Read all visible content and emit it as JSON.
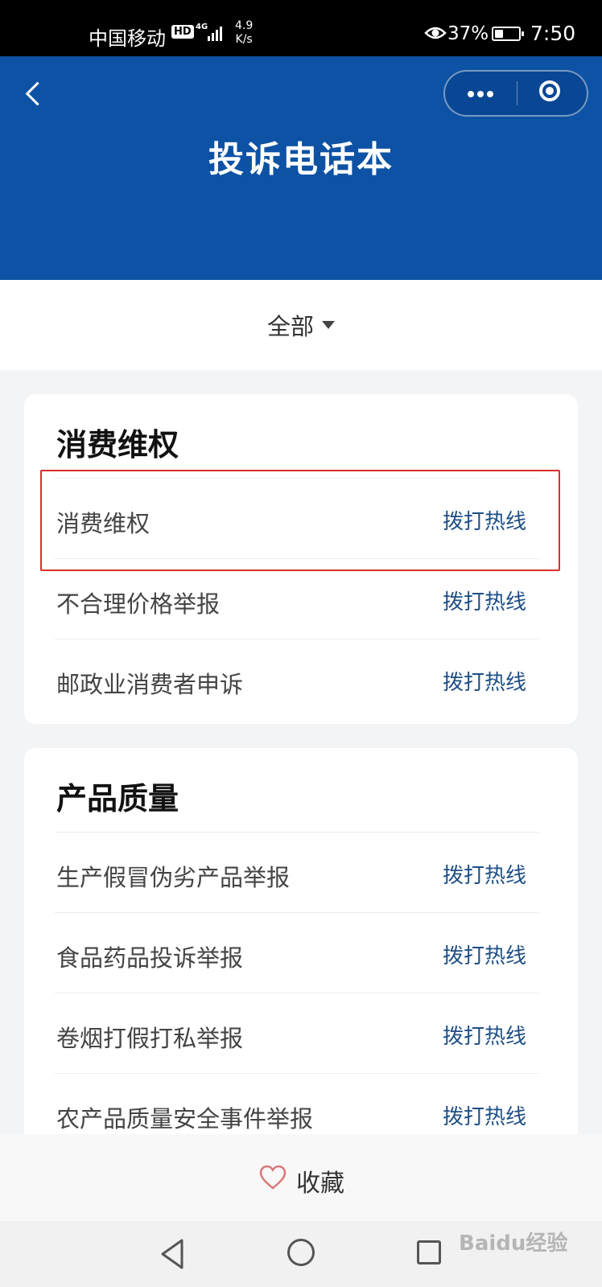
{
  "status_bar": {
    "carrier": "中国移动",
    "hd": "HD",
    "network": "4G",
    "speed_value": "4.9",
    "speed_unit": "K/s",
    "battery": "37%",
    "battery_level": 0.37,
    "time": "7:50"
  },
  "header": {
    "title": "投诉电话本",
    "background_color": "#0d52a4"
  },
  "filter": {
    "selected": "全部"
  },
  "sections": [
    {
      "title": "消费维权",
      "items": [
        {
          "label": "消费维权",
          "action": "拨打热线",
          "highlighted": true
        },
        {
          "label": "不合理价格举报",
          "action": "拨打热线"
        },
        {
          "label": "邮政业消费者申诉",
          "action": "拨打热线"
        }
      ]
    },
    {
      "title": "产品质量",
      "items": [
        {
          "label": "生产假冒伪劣产品举报",
          "action": "拨打热线"
        },
        {
          "label": "食品药品投诉举报",
          "action": "拨打热线"
        },
        {
          "label": "卷烟打假打私举报",
          "action": "拨打热线"
        },
        {
          "label": "农产品质量安全事件举报",
          "action": "拨打热线"
        }
      ]
    }
  ],
  "bottom": {
    "favorite_label": "收藏"
  },
  "watermark": "Baidu经验",
  "colors": {
    "accent": "#0d52a4",
    "link": "#1e4f86",
    "highlight": "#d9302c",
    "heart": "#d97b7b"
  },
  "icons": {
    "back": "chevron-left-icon",
    "more": "more-dots-icon",
    "close": "target-close-icon",
    "filter": "caret-down-icon",
    "favorite": "heart-icon",
    "nav_back": "triangle-back-icon",
    "nav_home": "circle-home-icon",
    "nav_recent": "square-recent-icon"
  }
}
